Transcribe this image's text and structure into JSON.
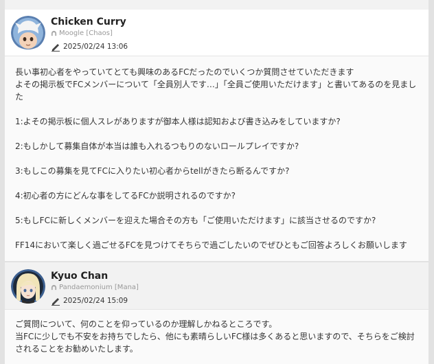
{
  "posts": [
    {
      "author": "Chicken Curry",
      "world": "Moogle [Chaos]",
      "date": "2025/02/24 13:06",
      "avatar_icon": "miqote-chef-avatar",
      "paragraphs": [
        "長い事初心者をやっていてとても興味のあるFCだったのでいくつか質問させていただきます\nよその掲示板でFCメンバーについて「全員別人です…」「全員ご使用いただけます」と書いてあるのを見ました",
        "1:よその掲示板に個人スレがありますが御本人様は認知および書き込みをしていますか?",
        "2:もしかして募集自体が本当は誰も入れるつもりのないロールプレイですか?",
        "3:もしこの募集を見てFCに入りたい初心者からtellがきたら断るんですか?",
        "4:初心者の方にどんな事をしてるFCか説明されるのですか?",
        "5:もしFCに新しくメンバーを迎えた場合その方も「ご使用いただけます」に該当させるのですか?",
        "FF14において楽しく過ごせるFCを見つけてそちらで過ごしたいのでぜひともご回答よろしくお願いします"
      ]
    },
    {
      "author": "Kyuo Chan",
      "world": "Pandaemonium [Mana]",
      "date": "2025/02/24 15:09",
      "avatar_icon": "blonde-character-avatar",
      "paragraphs": [
        "ご質問について、何のことを仰っているのか理解しかねるところです。\n当FCに少しでも不安をお持ちでしたら、他にも素晴らしいFC様は多くあると思いますので、そちらをご検討されることをお勧めいたします。"
      ]
    }
  ],
  "colors": {
    "page_bg": "#e2e2e2",
    "header_bg": "#ffffff",
    "alt_header_bg": "#f2f2f2",
    "body_bg": "#fafafa",
    "text": "#333333",
    "meta": "#999999"
  }
}
